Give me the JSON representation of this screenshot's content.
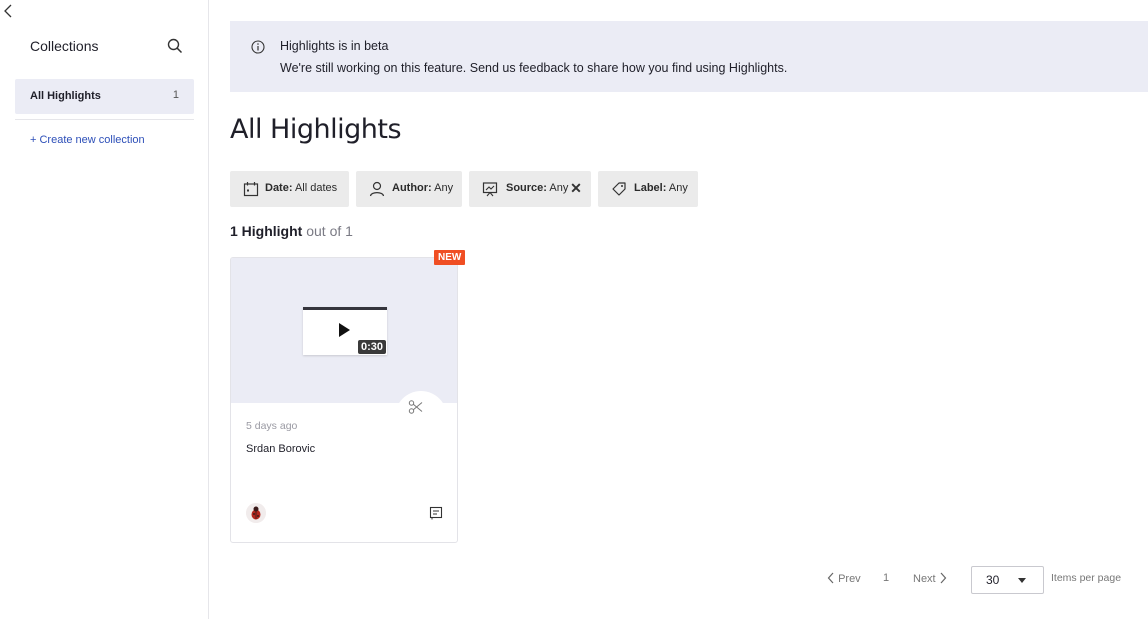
{
  "sidebar": {
    "title": "Collections",
    "items": [
      {
        "label": "All Highlights",
        "count": "1"
      }
    ],
    "create_label": "+ Create new collection"
  },
  "banner": {
    "title": "Highlights is in beta",
    "text": "We're still working on this feature. Send us feedback to share how you find using Highlights."
  },
  "page_title": "All Highlights",
  "filters": [
    {
      "key": "Date:",
      "value": "All dates",
      "icon": "calendar-icon"
    },
    {
      "key": "Author:",
      "value": "Any",
      "icon": "user-icon"
    },
    {
      "key": "Source:",
      "value": "Any",
      "icon": "presentation-icon",
      "clear": "✕"
    },
    {
      "key": "Label:",
      "value": "Any",
      "icon": "tag-icon"
    }
  ],
  "result_count": {
    "strong": "1 Highlight",
    "muted": " out of 1"
  },
  "cards": [
    {
      "badge": "NEW",
      "duration": "0:30",
      "date": "5 days ago",
      "author": "Srdan Borovic"
    }
  ],
  "pagination": {
    "prev": "Prev",
    "page": "1",
    "next": "Next",
    "per_page_value": "30",
    "per_page_label": "Items per page"
  },
  "colors": {
    "accent": "#2d4fb8",
    "badge": "#f04e23",
    "banner_bg": "#ebecf5"
  }
}
